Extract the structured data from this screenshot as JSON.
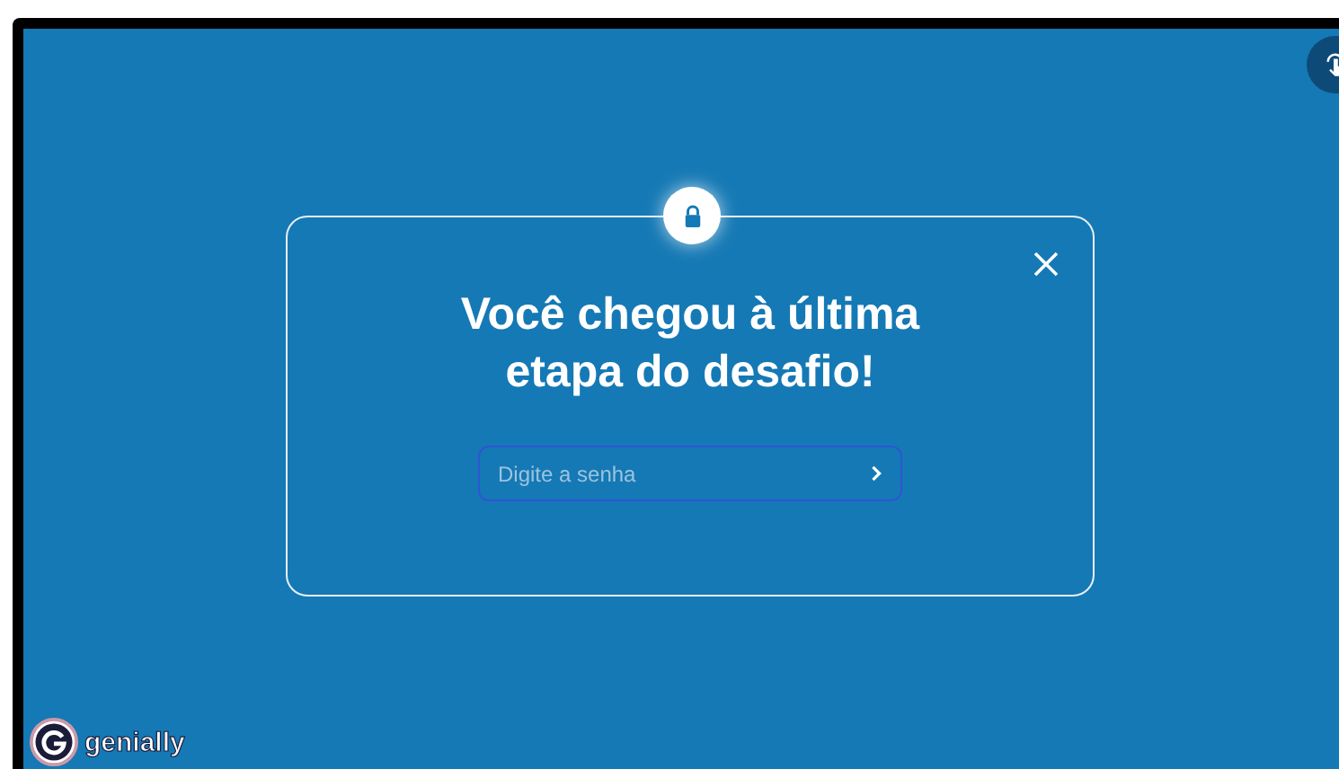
{
  "dialog": {
    "title": "Você chegou à última etapa do desafio!",
    "password_field": {
      "placeholder": "Digite a senha"
    }
  },
  "brand": {
    "name": "genially"
  }
}
